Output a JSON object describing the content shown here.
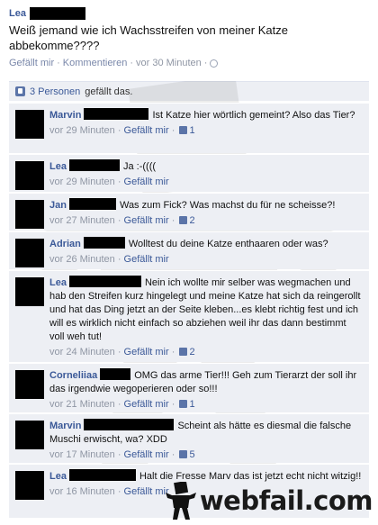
{
  "post": {
    "author": "Lea",
    "text": "Weiß jemand wie ich Wachsstreifen von meiner Katze abbekomme????",
    "like_label": "Gefällt mir",
    "comment_label": "Kommentieren",
    "time": "vor 30 Minuten",
    "sep": "·"
  },
  "likes": {
    "count_label": "3 Personen",
    "suffix": "gefällt das."
  },
  "comments": [
    {
      "author": "Marvin",
      "text": "Ist Katze hier wörtlich gemeint? Also das Tier?",
      "time": "vor 29 Minuten",
      "like": "Gefällt mir",
      "likes": "1"
    },
    {
      "author": "Lea",
      "text": "Ja :-((((",
      "time": "vor 29 Minuten",
      "like": "Gefällt mir",
      "likes": ""
    },
    {
      "author": "Jan",
      "text": "Was zum Fick? Was machst du für ne scheisse?!",
      "time": "vor 27 Minuten",
      "like": "Gefällt mir",
      "likes": "2"
    },
    {
      "author": "Adrian",
      "text": "Wolltest du deine Katze enthaaren oder was?",
      "time": "vor 26 Minuten",
      "like": "Gefällt mir",
      "likes": ""
    },
    {
      "author": "Lea",
      "text": "Nein ich wollte mir selber was wegmachen und hab den Streifen kurz hingelegt und meine Katze hat sich da reingerollt und hat das Ding jetzt an der Seite kleben...es klebt richtig fest und ich will es wirklich nicht einfach so abziehen weil ihr das dann bestimmt voll weh tut!",
      "time": "vor 24 Minuten",
      "like": "Gefällt mir",
      "likes": "2"
    },
    {
      "author": "Corneliiaa",
      "text": "OMG das arme Tier!!! Geh zum Tierarzt der soll ihr das irgendwie wegoperieren oder so!!!",
      "time": "vor 21 Minuten",
      "like": "Gefällt mir",
      "likes": "1"
    },
    {
      "author": "Marvin",
      "text": "Scheint als hätte es diesmal die falsche Muschi erwischt, wa? XDD",
      "time": "vor 17 Minuten",
      "like": "Gefällt mir",
      "likes": "5"
    },
    {
      "author": "Lea",
      "text": "Halt die Fresse Marv das ist jetzt echt nicht witzig!!",
      "time": "vor 16 Minuten",
      "like": "Gefällt mir",
      "likes": ""
    }
  ],
  "brand": {
    "text": "webfail.com"
  },
  "colors": {
    "link": "#3b5998",
    "ufi_bg": "#edeff4",
    "meta": "#8f96a4"
  }
}
